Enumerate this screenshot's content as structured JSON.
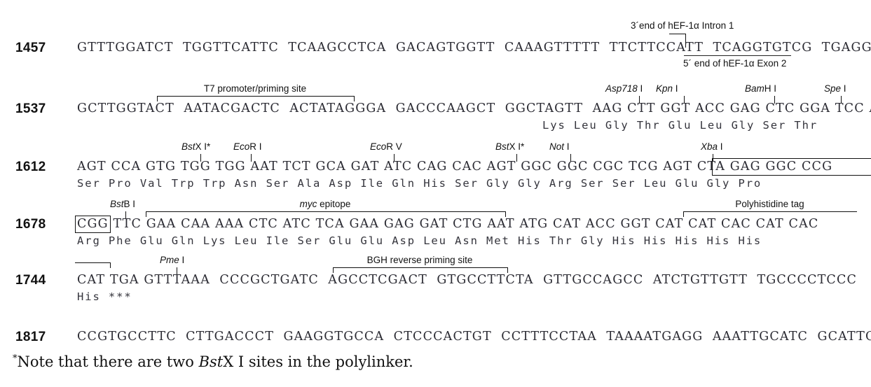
{
  "rows": [
    {
      "number": "1457",
      "sequence": "GTTTGGATCT  TGGTTCATTC  TCAAGCCTCA  GACAGTGGTT  CAAAGTTTTT  TTCTTCCATT  TCAGGTGTCG  TGAGGAATTA",
      "amino_acids": ""
    },
    {
      "number": "1537",
      "sequence": "GCTTGGTACT  AATACGACTC  ACTATAGGGA  GACCCAAGCT  GGCTAGTT  AAG CTT GGT ACC GAG CTC GGA TCC ACT",
      "amino_acids": "Lys Leu Gly Thr Glu Leu Gly Ser Thr"
    },
    {
      "number": "1612",
      "sequence": "AGT CCA GTG TGG TGG AAT TCT GCA GAT ATC CAG CAC AGT GGC GGC CGC TCG AGT CTA GAG GGC CCG",
      "amino_acids": "Ser Pro Val Trp Trp Asn Ser Ala Asp Ile Gln His Ser Gly Gly Arg Ser Ser Leu Glu Gly Pro"
    },
    {
      "number": "1678",
      "sequence": "CGG TTC GAA CAA AAA CTC ATC TCA GAA GAG GAT CTG AAT ATG CAT ACC GGT CAT CAT CAC CAT CAC",
      "amino_acids": "Arg Phe Glu Gln Lys Leu Ile Ser Glu Glu Asp Leu Asn Met His Thr Gly His His His His His"
    },
    {
      "number": "1744",
      "sequence": "CAT TGA GTTTAAA  CCCGCTGATC  AGCCTCGACT  GTGCCTTCTA  GTTGCCAGCC  ATCTGTTGTT  TGCCCCTCCC",
      "amino_acids": "His ***"
    },
    {
      "number": "1817",
      "sequence": "CCGTGCCTTC  CTTGACCCT  GAAGGTGCCA  CTCCCACTGT  CCTTTCCTAA  TAAAATGAGG  AAATTGCATC  GCATTGTCTC",
      "amino_acids": ""
    }
  ],
  "enzymes": [
    {
      "id": "asp718",
      "name": "Asp718",
      "suffix": " I",
      "italic": true
    },
    {
      "id": "kpn",
      "name": "Kpn",
      "suffix": " I",
      "italic": true
    },
    {
      "id": "bamh",
      "name": "Bam",
      "suffix": "H I",
      "italic": true
    },
    {
      "id": "spe",
      "name": "Spe",
      "suffix": " I",
      "italic": true
    },
    {
      "id": "bstx1",
      "name": "Bst",
      "suffix": "X I*",
      "italic": true
    },
    {
      "id": "ecori",
      "name": "Eco",
      "suffix": "R I",
      "italic": true
    },
    {
      "id": "ecorv",
      "name": "Eco",
      "suffix": "R V",
      "italic": true
    },
    {
      "id": "bstx2",
      "name": "Bst",
      "suffix": "X I*",
      "italic": true
    },
    {
      "id": "not",
      "name": "Not",
      "suffix": " I",
      "italic": true
    },
    {
      "id": "xba",
      "name": "Xba",
      "suffix": " I",
      "italic": true
    },
    {
      "id": "bstb",
      "name": "Bst",
      "suffix": "B I",
      "italic": true
    },
    {
      "id": "pme",
      "name": "Pme",
      "suffix": " I",
      "italic": true
    }
  ],
  "features": {
    "t7_promoter": "T7 promoter/priming site",
    "myc_epitope_pre": "myc",
    "myc_epitope_post": " epitope",
    "polyhistidine": "Polyhistidine tag",
    "bgh_reverse": "BGH reverse priming site",
    "intron_end": "3´end of hEF-1α Intron 1",
    "exon_start": "5´ end of hEF-1α Exon 2"
  },
  "footnote": {
    "marker": "*",
    "text_before": "Note that there are two ",
    "italic_part": "Bst",
    "text_after": "X I sites in the polylinker."
  },
  "colors": {
    "ink": "#111111",
    "sequence_ink": "#2b2b33",
    "background": "#ffffff"
  }
}
